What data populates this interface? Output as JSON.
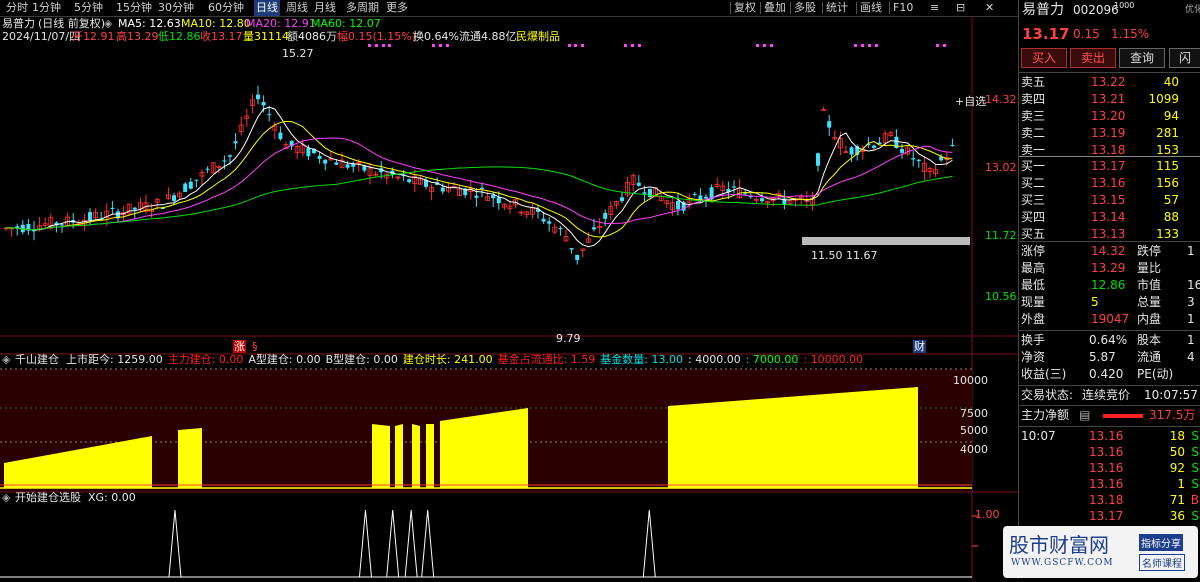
{
  "toolbar": {
    "items": [
      "分时",
      "1分钟",
      "5分钟",
      "15分钟",
      "30分钟",
      "60分钟",
      "日线",
      "周线",
      "月线",
      "多周期",
      "更多"
    ],
    "active_index": 6,
    "right_items": [
      "复权",
      "叠加",
      "多股",
      "统计",
      "画线",
      "F10"
    ],
    "win_buttons": [
      "≡",
      "⊟",
      "✕"
    ]
  },
  "chart_info": {
    "stock_name": "易普力",
    "period": "(日线 前复权)",
    "ma5": "MA5: 12.63",
    "ma10": "MA10: 12.80",
    "ma20": "MA20: 12.91",
    "ma60": "MA60: 12.07",
    "turnover_label": "换0.64%",
    "date": "2024/11/07/四",
    "open_lbl": "开12.91",
    "high_lbl": "高13.29",
    "low_lbl": "低12.86",
    "close_lbl": "收13.17",
    "vol_lbl": "量31114",
    "amount_lbl": "额4086万",
    "range_lbl": "幅0.15(1.15%)",
    "turnover2": "换0.64%",
    "float_lbl": "流通4.88亿",
    "sector": "民爆制品",
    "price_axis": [
      "14.32",
      "13.02",
      "11.72",
      "10.56"
    ],
    "high_mark": "15.27",
    "low_mark": "9.79",
    "marks": [
      "11.50",
      "11.67"
    ],
    "self_select": "+自选",
    "tag_zhang": "涨",
    "tag_cai": "财"
  },
  "chart_data": {
    "type": "line",
    "panels": [
      "candlestick",
      "indicator_area",
      "signal_line"
    ],
    "price_ticks": [
      14.32,
      13.02,
      11.72,
      10.56
    ],
    "price_high": 15.27,
    "price_low": 9.79,
    "ind1_ticks": [
      10000,
      7500,
      5000,
      4000
    ],
    "ind1_axis_labels": [
      "10000",
      "7500",
      "5000",
      "4000"
    ],
    "ind2_ticks": [
      1.0,
      0.0
    ],
    "ind2_axis_labels": [
      "1.00",
      "0.00"
    ],
    "signal_positions_pct": [
      18.0,
      37.6,
      40.4,
      42.3,
      44.0,
      66.8
    ]
  },
  "indicator1": {
    "title": "千山建仓",
    "fields": [
      {
        "t": "上市距今: 1259.00",
        "c": "#e6e6e6"
      },
      {
        "t": "主力建仓: 0.00",
        "c": "#ff2020"
      },
      {
        "t": "A型建仓: 0.00",
        "c": "#e6e6e6"
      },
      {
        "t": "B型建仓: 0.00",
        "c": "#e6e6e6"
      },
      {
        "t": "建仓时长: 241.00",
        "c": "#ffff00"
      },
      {
        "t": "基金占流通比: 1.59",
        "c": "#ff2020"
      },
      {
        "t": "基金数量: 13.00",
        "c": "#00e0e0"
      },
      {
        "t": ": 4000.00",
        "c": "#e6e6e6"
      },
      {
        "t": ": 7000.00",
        "c": "#00ff00"
      },
      {
        "t": ": 10000.00",
        "c": "#ff2020"
      }
    ]
  },
  "indicator2": {
    "title": "开始建仓选股",
    "xg": "XG: 0.00"
  },
  "quote": {
    "name": "易普力",
    "code": "002096",
    "code_sup": "1000",
    "price": "13.17",
    "change": "0.15",
    "pct": "1.15%",
    "buttons": [
      "买入",
      "卖出",
      "查询",
      "闪"
    ],
    "asks": [
      {
        "l": "卖五",
        "p": "13.22",
        "v": "40"
      },
      {
        "l": "卖四",
        "p": "13.21",
        "v": "1099"
      },
      {
        "l": "卖三",
        "p": "13.20",
        "v": "94"
      },
      {
        "l": "卖二",
        "p": "13.19",
        "v": "281"
      },
      {
        "l": "卖一",
        "p": "13.18",
        "v": "153"
      }
    ],
    "bids": [
      {
        "l": "买一",
        "p": "13.17",
        "v": "115"
      },
      {
        "l": "买二",
        "p": "13.16",
        "v": "156"
      },
      {
        "l": "买三",
        "p": "13.15",
        "v": "57"
      },
      {
        "l": "买四",
        "p": "13.14",
        "v": "88"
      },
      {
        "l": "买五",
        "p": "13.13",
        "v": "133"
      }
    ],
    "stats": [
      {
        "a": "涨停",
        "av": "14.32",
        "ac": "#ff4040",
        "b": "跌停",
        "bv": "1"
      },
      {
        "a": "最高",
        "av": "13.29",
        "ac": "#ff4040",
        "b": "量比",
        "bv": ""
      },
      {
        "a": "最低",
        "av": "12.86",
        "ac": "#00e000",
        "b": "市值",
        "bv": "16"
      },
      {
        "a": "现量",
        "av": "5",
        "ac": "#ffff00",
        "b": "总量",
        "bv": "3"
      },
      {
        "a": "外盘",
        "av": "19047",
        "ac": "#ff4040",
        "b": "内盘",
        "bv": "1"
      }
    ],
    "stats2": [
      {
        "a": "换手",
        "av": "0.64%",
        "b": "股本",
        "bv": "1"
      },
      {
        "a": "净资",
        "av": "5.87",
        "b": "流通",
        "bv": "4"
      },
      {
        "a": "收益(三)",
        "av": "0.420",
        "b": "PE(动)",
        "bv": ""
      }
    ],
    "trade_status_label": "交易状态:",
    "trade_status": "连续竞价",
    "trade_time": "10:07:57",
    "net_label": "主力净额",
    "net_value": "317.5万",
    "ticks": [
      {
        "t": "10:07",
        "p": "13.16",
        "v": "18",
        "s": "S"
      },
      {
        "t": "",
        "p": "13.16",
        "v": "50",
        "s": "S"
      },
      {
        "t": "",
        "p": "13.16",
        "v": "92",
        "s": "S"
      },
      {
        "t": "",
        "p": "13.16",
        "v": "1",
        "s": "S"
      },
      {
        "t": "",
        "p": "13.18",
        "v": "71",
        "s": "B"
      },
      {
        "t": "",
        "p": "13.17",
        "v": "36",
        "s": "S"
      }
    ],
    "top_right_tag": "优化"
  },
  "watermark": {
    "title": "股市财富网",
    "url": "WWW.GSCFW.COM",
    "tag1": "指标分享",
    "tag2": "名师课程"
  }
}
